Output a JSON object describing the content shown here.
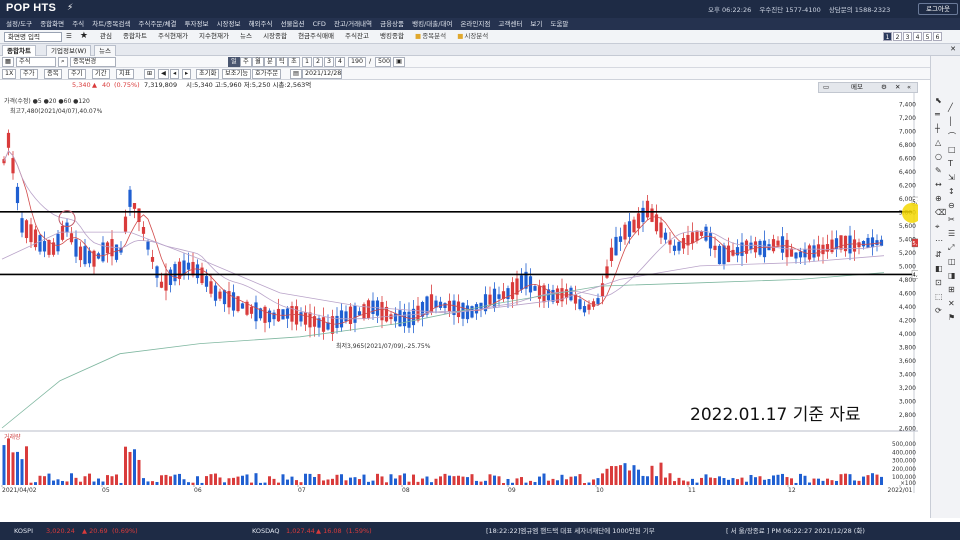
{
  "app": {
    "logo": "POP HTS",
    "logo_mark": "®",
    "bolt_icon": "⚡"
  },
  "system": {
    "time": "오후 06:22:26",
    "call": "우수진단 1577-4100",
    "center": "상담문의 1588-2323",
    "logout": "로그아웃"
  },
  "menu": [
    "설정/도구",
    "종합화면",
    "주식",
    "차트/종목검색",
    "주식주문/체결",
    "투자정보",
    "시장정보",
    "해외주식",
    "선물옵션",
    "CFD",
    "잔고/거래내역",
    "금융상품",
    "뱅킹/대출/대여",
    "온라인지점",
    "고객센터",
    "보기",
    "도움말"
  ],
  "quickbar": {
    "screen_select": "화면명 입력",
    "items": [
      "관심",
      "종합차트",
      "주식현재가",
      "지수현재가",
      "뉴스",
      "시장종합",
      "현금주식매매",
      "주식잔고",
      "뱅킹종합"
    ],
    "folders": [
      "종목분석",
      "시장분석"
    ],
    "pages": [
      "1",
      "2",
      "3",
      "4",
      "5",
      "6"
    ]
  },
  "tabs": [
    "종합차트",
    "기업정보(W)",
    "뉴스"
  ],
  "toolbar1": {
    "market": "주식",
    "search_label": "종목변경",
    "buttons": [
      "일",
      "주",
      "월",
      "분",
      "틱",
      "초"
    ],
    "num_btns": [
      "1",
      "2",
      "3",
      "4"
    ],
    "count": "190",
    "total": "500"
  },
  "toolbar2": {
    "unit_buttons": [
      "1X",
      "주가",
      "종목",
      "주기",
      "기간",
      "지표"
    ],
    "buttons": [
      "초기화",
      "보조기능",
      "호가주문"
    ],
    "date": "2021/12/28"
  },
  "info": {
    "price": "5,340",
    "change_sign": "▲",
    "change": "40",
    "change_pct": "(0.75%)",
    "volume": "7,319,809",
    "ohlc": "시:5,340 고:5,960 저:5,250 시총:2,563억"
  },
  "memo": {
    "label": "메모"
  },
  "legend_price": "가격(수정) ●5 ●20 ●60 ●120",
  "high_label": "최고7,480(2021/04/07),40.07%",
  "low_label": "최저3,965(2021/07/09),-25.75%",
  "volume_legend": "거래량",
  "note": "2022.01.17 기준 자료",
  "price_axis": [
    "7,400",
    "7,200",
    "7,000",
    "6,800",
    "6,600",
    "6,400",
    "6,200",
    "6,000",
    "5,800",
    "5,600",
    "5,400",
    "5,200",
    "5,000",
    "4,800",
    "4,600",
    "4,400",
    "4,200",
    "4,000",
    "3,800",
    "3,600",
    "3,400",
    "3,200",
    "3,000",
    "2,800",
    "2,600"
  ],
  "price_tags": {
    "hline_high": "5,960",
    "current": "5,340",
    "hline_low": "4,874"
  },
  "volume_axis": [
    "500,000",
    "400,000",
    "300,000",
    "200,000",
    "100,000"
  ],
  "volume_unit": "×100",
  "date_axis": [
    "2021/04/02",
    "05",
    "06",
    "07",
    "08",
    "09",
    "10",
    "11",
    "12",
    "2022/01"
  ],
  "date_axis_pos": [
    "2021/04/02"
  ],
  "bottombar": {
    "kospi_label": "KOSPI",
    "kospi": "3,020.24",
    "kospi_chg": "▲ 20.69",
    "kospi_pct": "(0.69%)",
    "kosdaq_label": "KOSDAQ",
    "kosdaq": "1,027.44",
    "kosdaq_chg": "▲ 16.08",
    "kosdaq_pct": "(1.59%)",
    "news": "[18:22:22]엠규엠 핸드택 대표 세자녀재단에 1000만원 기부",
    "status": "[ 서 울/장종료 ] PM 06:22:27  2021/12/28 (화)"
  },
  "colors": {
    "up": "#d93b3b",
    "down": "#1f5fd1",
    "ma5": "#d14a4a",
    "ma20": "#b9a3c9",
    "ma60": "#7fb7a0",
    "ma120": "#7fc7a0",
    "hline": "#000000",
    "nav": "#1e2b45"
  }
}
